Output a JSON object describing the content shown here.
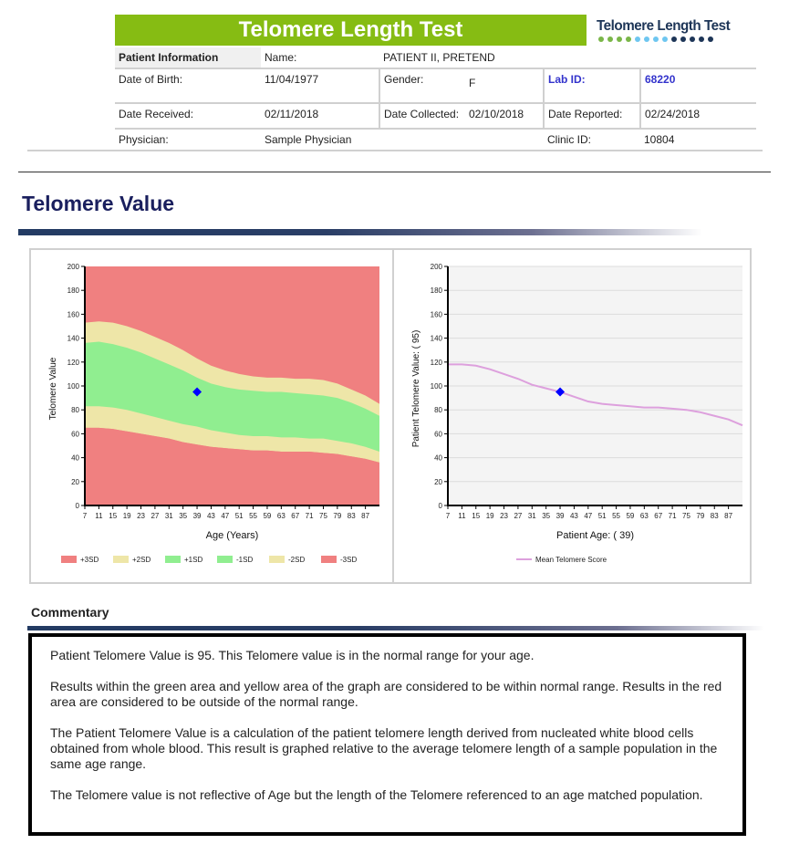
{
  "header": {
    "banner_title": "Telomere Length Test",
    "logo_text": "Telomere Length Test",
    "logo_dot_colors": [
      "#7ab648",
      "#7ab648",
      "#7ab648",
      "#7ab648",
      "#6ec6f0",
      "#6ec6f0",
      "#6ec6f0",
      "#6ec6f0",
      "#1d3557",
      "#1d3557",
      "#1d3557",
      "#1d3557",
      "#1d3557"
    ]
  },
  "patient": {
    "section_label": "Patient Information",
    "name_label": "Name:",
    "name_value": "PATIENT II, PRETEND",
    "dob_label": "Date of Birth:",
    "dob_value": "11/04/1977",
    "gender_label": "Gender:",
    "gender_value": "F",
    "labid_label": "Lab ID:",
    "labid_value": "68220",
    "received_label": "Date Received:",
    "received_value": "02/11/2018",
    "collected_label": "Date Collected:",
    "collected_value": "02/10/2018",
    "reported_label": "Date Reported:",
    "reported_value": "02/24/2018",
    "physician_label": "Physician:",
    "physician_value": "Sample Physician",
    "clinic_label": "Clinic ID:",
    "clinic_value": "10804"
  },
  "section_title": "Telomere Value",
  "chart_data": [
    {
      "type": "area",
      "title": "",
      "xlabel": "Age (Years)",
      "ylabel": "Telomere  Value",
      "xlim": [
        7,
        91
      ],
      "ylim": [
        0,
        200
      ],
      "yticks": [
        0,
        20,
        40,
        60,
        80,
        100,
        120,
        140,
        160,
        180,
        200
      ],
      "xticks": [
        7,
        11,
        15,
        19,
        23,
        27,
        31,
        35,
        39,
        43,
        47,
        51,
        55,
        59,
        63,
        67,
        71,
        75,
        79,
        83,
        87
      ],
      "x": [
        7,
        11,
        15,
        19,
        23,
        27,
        31,
        35,
        39,
        43,
        47,
        51,
        55,
        59,
        63,
        67,
        71,
        75,
        79,
        83,
        87,
        91
      ],
      "boundaries": {
        "plus2sd_top": [
          153,
          154,
          153,
          150,
          146,
          141,
          136,
          130,
          123,
          117,
          113,
          110,
          108,
          107,
          107,
          106,
          106,
          105,
          102,
          97,
          92,
          85
        ],
        "plus1sd_top": [
          136,
          137,
          135,
          132,
          128,
          123,
          118,
          113,
          107,
          102,
          99,
          97,
          96,
          95,
          95,
          94,
          93,
          92,
          90,
          86,
          81,
          75
        ],
        "minus1sd_bot": [
          83,
          83,
          82,
          80,
          77,
          74,
          71,
          68,
          66,
          63,
          61,
          59,
          58,
          58,
          57,
          57,
          56,
          56,
          54,
          52,
          49,
          45
        ],
        "minus2sd_bot": [
          65,
          65,
          64,
          62,
          60,
          58,
          56,
          53,
          51,
          49,
          48,
          47,
          46,
          46,
          45,
          45,
          45,
          44,
          43,
          41,
          39,
          36
        ]
      },
      "legend": [
        "+3SD",
        "+2SD",
        "+1SD",
        "-1SD",
        "-2SD",
        "-3SD"
      ],
      "legend_colors": [
        "#f08080",
        "#eee6a8",
        "#90ee90",
        "#90ee90",
        "#eee6a8",
        "#f08080"
      ],
      "legend_position": "bottom",
      "patient_point": {
        "x": 39,
        "y": 95
      },
      "colors": {
        "red": "#f08080",
        "yellow": "#eee6a8",
        "green": "#90ee90",
        "point": "#0000ff"
      }
    },
    {
      "type": "line",
      "title": "",
      "xlabel": "Patient Age: ( 39)",
      "ylabel": "Patient Telomere Value: ( 95)",
      "xlim": [
        7,
        91
      ],
      "ylim": [
        0,
        200
      ],
      "yticks": [
        0,
        20,
        40,
        60,
        80,
        100,
        120,
        140,
        160,
        180,
        200
      ],
      "xticks": [
        7,
        11,
        15,
        19,
        23,
        27,
        31,
        35,
        39,
        43,
        47,
        51,
        55,
        59,
        63,
        67,
        71,
        75,
        79,
        83,
        87
      ],
      "grid": true,
      "series": [
        {
          "name": "Mean Telomere Score",
          "color": "#dda0dd",
          "x": [
            7,
            11,
            15,
            19,
            23,
            27,
            31,
            35,
            39,
            43,
            47,
            51,
            55,
            59,
            63,
            67,
            71,
            75,
            79,
            83,
            87,
            91
          ],
          "values": [
            118,
            118,
            117,
            114,
            110,
            106,
            101,
            98,
            95,
            91,
            87,
            85,
            84,
            83,
            82,
            82,
            81,
            80,
            78,
            75,
            72,
            67
          ]
        }
      ],
      "legend": [
        "Mean Telomere Score"
      ],
      "legend_position": "bottom",
      "patient_point": {
        "x": 39,
        "y": 95
      },
      "colors": {
        "background": "#f4f4f4",
        "point": "#0000ff"
      }
    }
  ],
  "commentary": {
    "title": "Commentary",
    "lead": "Patient Telomere Value is 95. This Telomere value is in the normal range for your age.",
    "p1": "Results within the green area and yellow area of the graph are considered to be within normal range. Results in the red area are considered to be outside of the normal range.",
    "p2": "The Patient Telomere Value is a calculation of the patient telomere length derived from nucleated white blood cells obtained from whole blood. This result is graphed relative to the average telomere length of a sample population in the same age range.",
    "p3": "The Telomere value is not reflective of Age but the length of the Telomere referenced to an age matched population."
  }
}
